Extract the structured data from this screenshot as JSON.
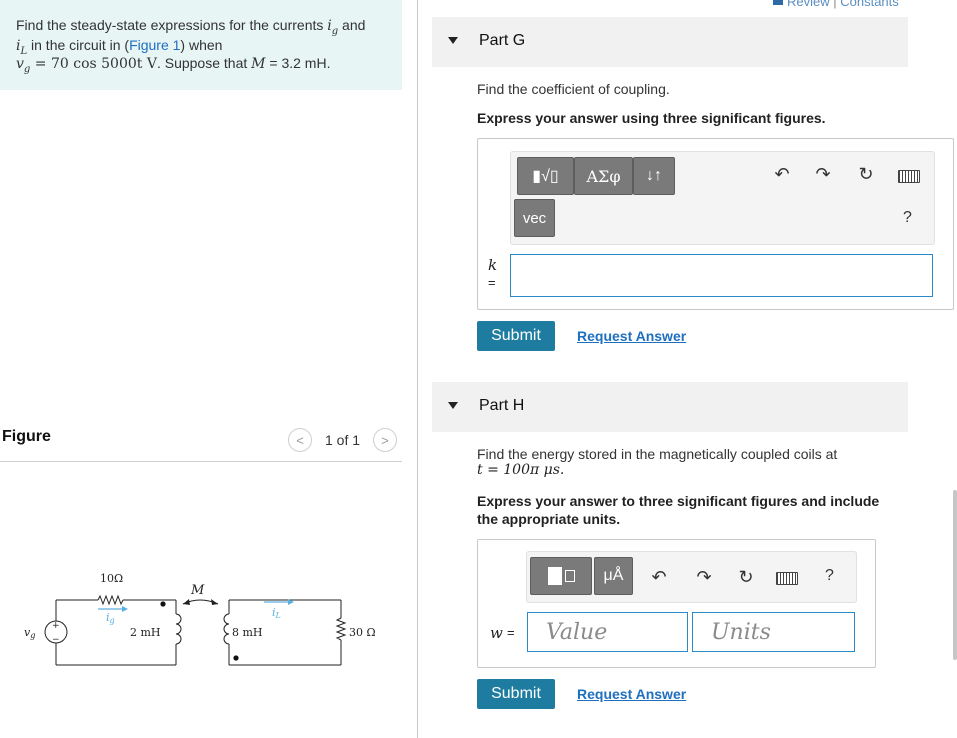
{
  "problem": {
    "line1_a": "Find the steady-state expressions for the currents ",
    "ig": "i",
    "ig_sub": "g",
    "line1_b": " and",
    "il": "i",
    "il_sub": "L",
    "line2_a": " in the circuit in (",
    "figure_link": "Figure 1",
    "line2_b": ") when",
    "vg_expr": "v",
    "vg_sub": "g",
    "vg_rest": " = 70 cos 5000t V",
    "line3_b": ". Suppose that ",
    "m_expr": "M",
    "m_val": " = 3.2 mH",
    "line3_end": "."
  },
  "review": {
    "review_label": "Review",
    "sep": " | ",
    "constants_label": "Constants"
  },
  "figure": {
    "title": "Figure",
    "pager": "1 of 1",
    "prev": "<",
    "next": ">",
    "circuit": {
      "r1": "10Ω",
      "ig_label": "i",
      "ig_sub": "g",
      "l1": "2 mH",
      "m_label": "M",
      "l2": "8 mH",
      "il_label": "i",
      "il_sub": "L",
      "r2": "30 Ω",
      "vg_label": "v",
      "vg_sub": "g",
      "plus": "+",
      "minus": "−"
    }
  },
  "partG": {
    "title": "Part G",
    "question": "Find the coefficient of coupling.",
    "instruction": "Express your answer using three significant figures.",
    "toolbar": {
      "templates": "▮√▯",
      "greek": "ΑΣφ",
      "arrows": "↓↑",
      "vec": "vec",
      "help": "?"
    },
    "var": "k",
    "eq": "=",
    "input_value": "",
    "submit": "Submit",
    "request": "Request Answer"
  },
  "partH": {
    "title": "Part H",
    "question": "Find the energy stored in the magnetically coupled coils at",
    "time_expr": "t = 100π μs.",
    "instruction_1": "Express your answer to three significant figures and include",
    "instruction_2": "the appropriate units.",
    "toolbar": {
      "units_sym": "μÅ",
      "help": "?"
    },
    "var": "w",
    "eq": "=",
    "value_placeholder": "Value",
    "units_placeholder": "Units",
    "submit": "Submit",
    "request": "Request Answer"
  },
  "colors": {
    "accent": "#1e7ca0",
    "link": "#1f6fbf",
    "problem_bg": "#e7f5f5",
    "input_border": "#2a8ac8"
  },
  "icons": [
    "undo-icon",
    "redo-icon",
    "reset-icon",
    "keyboard-icon",
    "triangle-down-icon"
  ]
}
